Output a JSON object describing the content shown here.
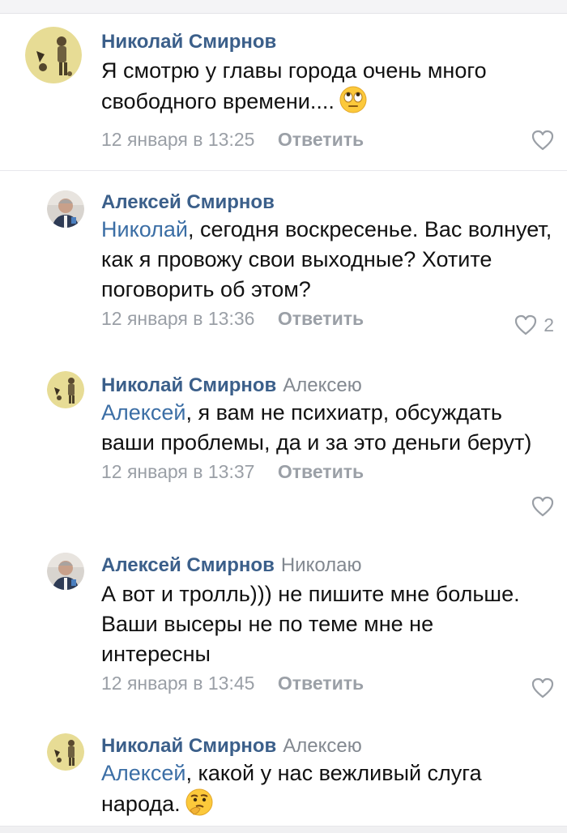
{
  "reply_label": "Ответить",
  "colors": {
    "author": "#3b5f8a",
    "mention": "#3b6ea5",
    "meta": "#9a9fa6",
    "text": "#111111"
  },
  "comments": [
    {
      "author": "Николай Смирнов",
      "reply_to": "",
      "mention": "",
      "text": "Я смотрю у главы города очень много свободного времени....",
      "emoji": "face-with-rolling-eyes-emoji",
      "date": "12 января в 13:25",
      "likes": ""
    },
    {
      "author": "Алексей Смирнов",
      "reply_to": "",
      "mention": "Николай",
      "text": ", сегодня воскресенье. Вас волнует, как я провожу свои выходные? Хотите поговорить об этом?",
      "date": "12 января в 13:36",
      "likes": "2"
    },
    {
      "author": "Николай Смирнов",
      "reply_to": "Алексею",
      "mention": "Алексей",
      "text": ", я вам не психиатр, обсуждать ваши проблемы, да и за это деньги берут)",
      "date": "12 января в 13:37",
      "likes": ""
    },
    {
      "author": "Алексей Смирнов",
      "reply_to": "Николаю",
      "mention": "",
      "text": "А вот и тролль))) не пишите мне больше. Ваши высеры не по теме мне не интересны",
      "date": "12 января в 13:45",
      "likes": ""
    },
    {
      "author": "Николай Смирнов",
      "reply_to": "Алексею",
      "mention": "Алексей",
      "text": ", какой у нас вежливый слуга народа.",
      "emoji": "thinking-face-emoji",
      "date": "",
      "likes": ""
    }
  ]
}
